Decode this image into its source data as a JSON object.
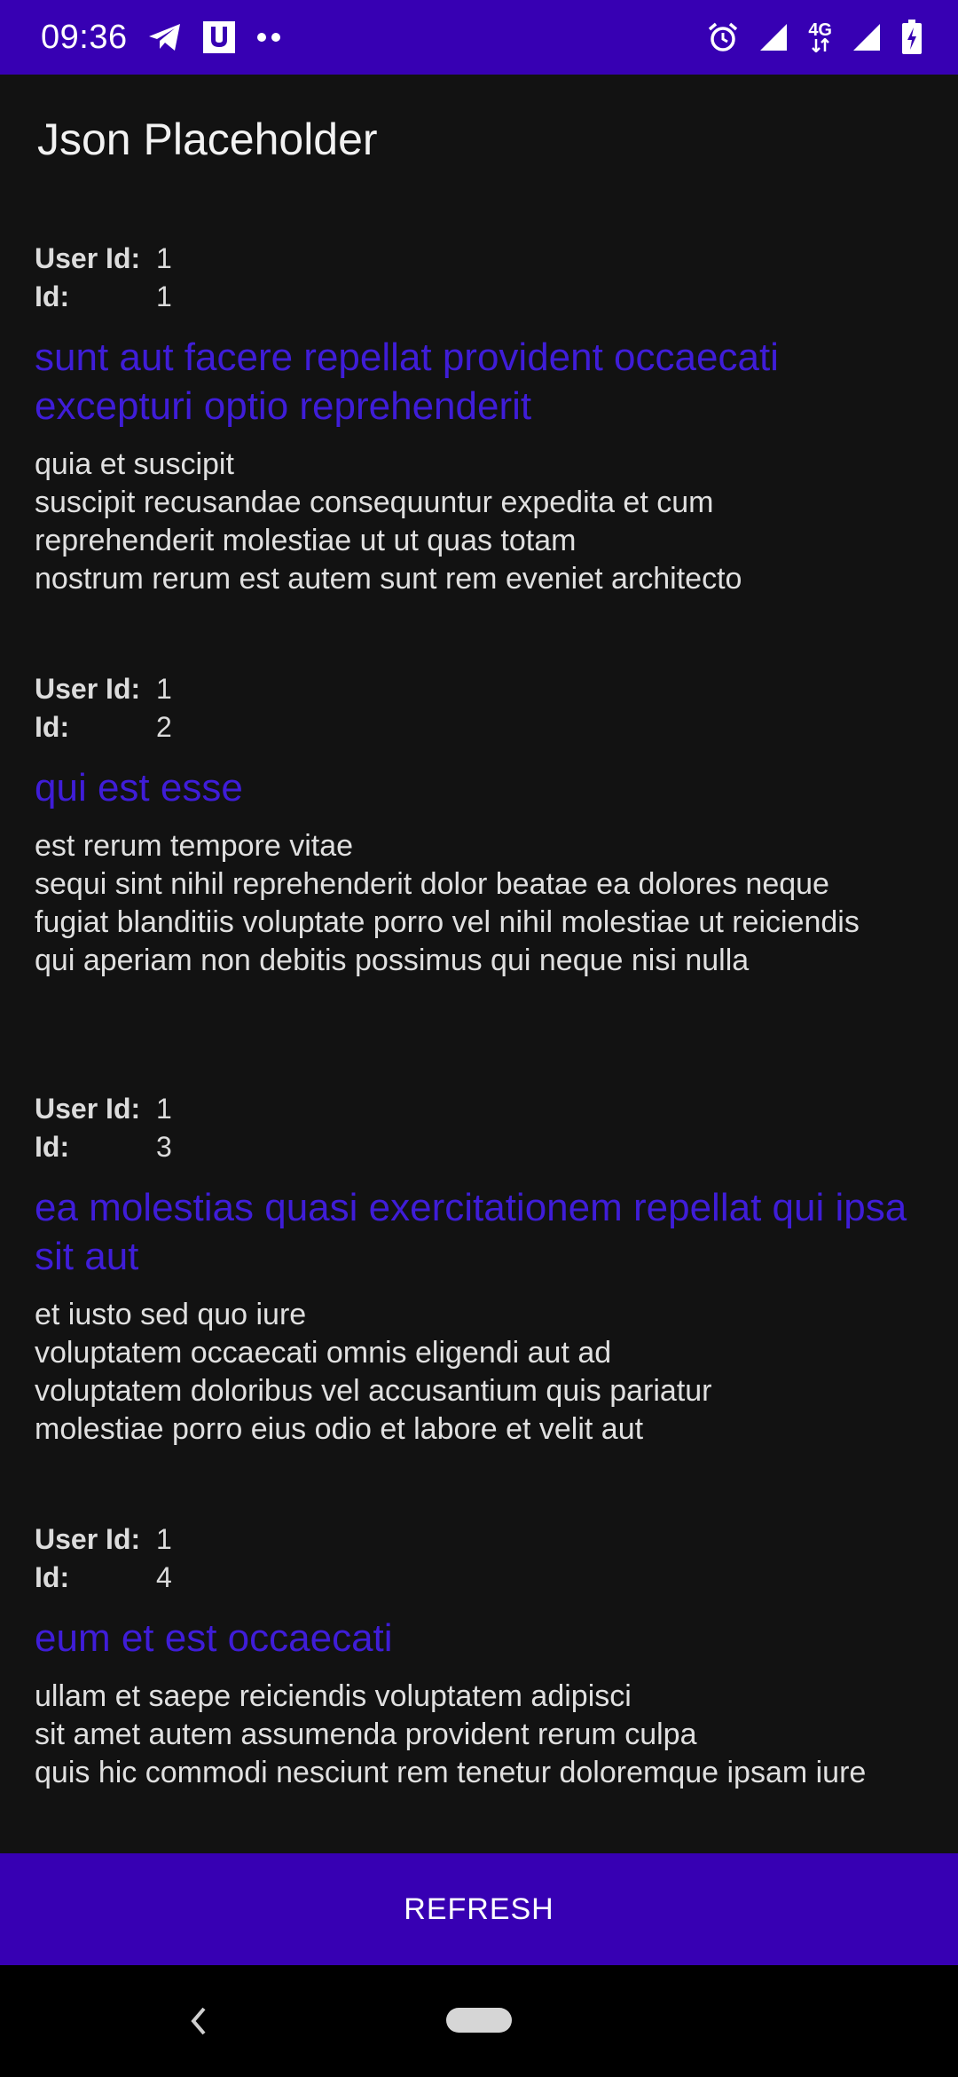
{
  "status_bar": {
    "time": "09:36",
    "network_label": "4G",
    "icons": [
      "telegram-icon",
      "u-app-icon",
      "more-dots-icon",
      "alarm-icon",
      "signal-icon",
      "signal-icon",
      "battery-charging-icon"
    ]
  },
  "app_bar": {
    "title": "Json Placeholder"
  },
  "labels": {
    "user_id": "User Id:",
    "id": "Id:"
  },
  "posts": [
    {
      "user_id": "1",
      "id": "1",
      "title": "sunt aut facere repellat provident occaecati excepturi optio reprehenderit",
      "body": "quia et suscipit\nsuscipit recusandae consequuntur expedita et cum\nreprehenderit molestiae ut ut quas totam\nnostrum rerum est autem sunt rem eveniet architecto"
    },
    {
      "user_id": "1",
      "id": "2",
      "title": "qui est esse",
      "body": "est rerum tempore vitae\nsequi sint nihil reprehenderit dolor beatae ea dolores neque\nfugiat blanditiis voluptate porro vel nihil molestiae ut reiciendis\nqui aperiam non debitis possimus qui neque nisi nulla"
    },
    {
      "user_id": "1",
      "id": "3",
      "title": "ea molestias quasi exercitationem repellat qui ipsa sit aut",
      "body": "et iusto sed quo iure\nvoluptatem occaecati omnis eligendi aut ad\nvoluptatem doloribus vel accusantium quis pariatur\nmolestiae porro eius odio et labore et velit aut"
    },
    {
      "user_id": "1",
      "id": "4",
      "title": "eum et est occaecati",
      "body": "ullam et saepe reiciendis voluptatem adipisci\nsit amet autem assumenda provident rerum culpa\nquis hic commodi nesciunt rem tenetur doloremque ipsam iure"
    }
  ],
  "refresh_button": {
    "label": "REFRESH"
  },
  "colors": {
    "primary": "#3700B3",
    "title_text": "#3F1DD8",
    "background": "#121212"
  }
}
